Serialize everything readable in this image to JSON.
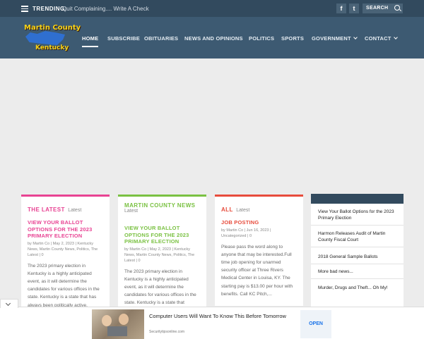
{
  "topbar": {
    "trending_label": "TRENDING:",
    "trending_text": "Quit Complaining.... Write A Check",
    "social": [
      {
        "label": "f",
        "icon": "facebook-icon"
      },
      {
        "label": "t",
        "icon": "twitter-icon"
      }
    ],
    "search_placeholder": "SEARCH"
  },
  "logo": {
    "line1": "Martin County",
    "line2": "Kentucky"
  },
  "nav": {
    "items": [
      "HOME",
      "SUBSCRIBE",
      "OBITUARIES",
      "NEWS AND OPINIONS",
      "POLITICS",
      "SPORTS",
      "GOVERNMENT",
      "CONTACT"
    ],
    "active": "HOME"
  },
  "cards": [
    {
      "title": "THE LATEST",
      "subtitle": "Latest",
      "accent": "#e84393",
      "post_title": "VIEW YOUR BALLOT OPTIONS FOR THE 2023 PRIMARY ELECTION",
      "meta": "by Martin Co | May 2, 2023 | Kentucky News, Martin County News, Politics, The Latest | 0",
      "body": "The 2023 primary election in Kentucky is a highly anticipated event, as it will determine the candidates for various offices in the state. Kentucky is a state that has always been politically active,"
    },
    {
      "title": "MARTIN COUNTY NEWS",
      "subtitle": "Latest",
      "accent": "#7ac142",
      "post_title": "VIEW YOUR BALLOT OPTIONS FOR THE 2023 PRIMARY ELECTION",
      "meta": "by Martin Co | May 2, 2023 | Kentucky News, Martin County News, Politics, The Latest | 0",
      "body": "The 2023 primary election in Kentucky is a highly anticipated event, as it will determine the candidates for various offices in the state. Kentucky is a state that"
    },
    {
      "title": "ALL",
      "subtitle": "Latest",
      "accent": "#e74c3c",
      "post_title": "JOB POSTING",
      "meta": "by Martin Co | Jun 16, 2023 | Uncategorized | 0",
      "body": "Please pass the word along to anyone that may be interested.Full time job opening for unarmed security officer at Three Rivers Medical Center in Louisa, KY. The starting pay is $13.00 per hour with benefits. Call KC Pitch,..."
    }
  ],
  "sidebar": {
    "items": [
      "View Your Ballot Options for the 2023 Primary Election",
      "Harmon Releases Audit of Martin County Fiscal Court",
      "2018 General Sample Ballots",
      "More bad news...",
      "Murder, Drugs and Theft... Oh My!"
    ]
  },
  "ad": {
    "headline": "Computer Users Will Want To Know This Before Tomorrow",
    "source": "Securitytipsonline.com",
    "cta": "OPEN"
  },
  "colors": {
    "topbar": "#324a5e",
    "navbar": "#3d5a72",
    "logo_yellow": "#f5d21a"
  }
}
